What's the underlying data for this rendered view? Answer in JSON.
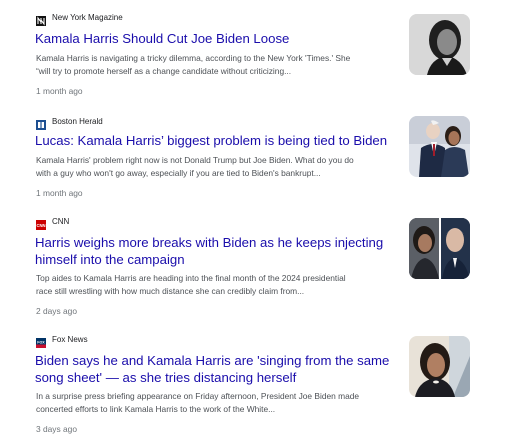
{
  "articles": [
    {
      "source": "New York Magazine",
      "source_icon": "nymag-logo-icon",
      "title": "Kamala Harris Should Cut Joe Biden Loose",
      "snippet_line1": "Kamala Harris is navigating a tricky dilemma, according to the New York 'Times.' She",
      "snippet_line2": "“will try to promote herself as a change candidate without criticizing...",
      "age": "1 month ago",
      "thumbnail": "kamala-harris-portrait-photo"
    },
    {
      "source": "Boston Herald",
      "source_icon": "boston-herald-logo-icon",
      "title": "Lucas: Kamala Harris’ biggest problem is being tied to Biden",
      "snippet_line1": "Kamala Harris' problem right now is not Donald Trump but Joe Biden. What do you do",
      "snippet_line2": "with a guy who won't go away, especially if you are tied to Biden's bankrupt...",
      "age": "1 month ago",
      "thumbnail": "biden-harris-photo"
    },
    {
      "source": "CNN",
      "source_icon": "cnn-logo-icon",
      "title_line1": "Harris weighs more breaks with Biden as he keeps injecting",
      "title_line2": "himself into the campaign",
      "snippet_line1": "Top aides to Kamala Harris are heading into the final month of the 2024 presidential",
      "snippet_line2": "race still wrestling with how much distance she can credibly claim from...",
      "age": "2 days ago",
      "thumbnail": "harris-biden-split-photo"
    },
    {
      "source": "Fox News",
      "source_icon": "fox-news-logo-icon",
      "title_line1": "Biden says he and Kamala Harris are 'singing from the same",
      "title_line2": "song sheet' — as she tries distancing herself",
      "snippet_line1": "In a surprise press briefing appearance on Friday afternoon, President Joe Biden made",
      "snippet_line2": "concerted efforts to link Kamala Harris to the work of the White...",
      "age": "3 days ago",
      "thumbnail": "kamala-harris-photo"
    }
  ],
  "colors": {
    "headline": "#1a0dab",
    "snippet": "#4d5156",
    "meta": "#70757a",
    "source": "#202124"
  }
}
